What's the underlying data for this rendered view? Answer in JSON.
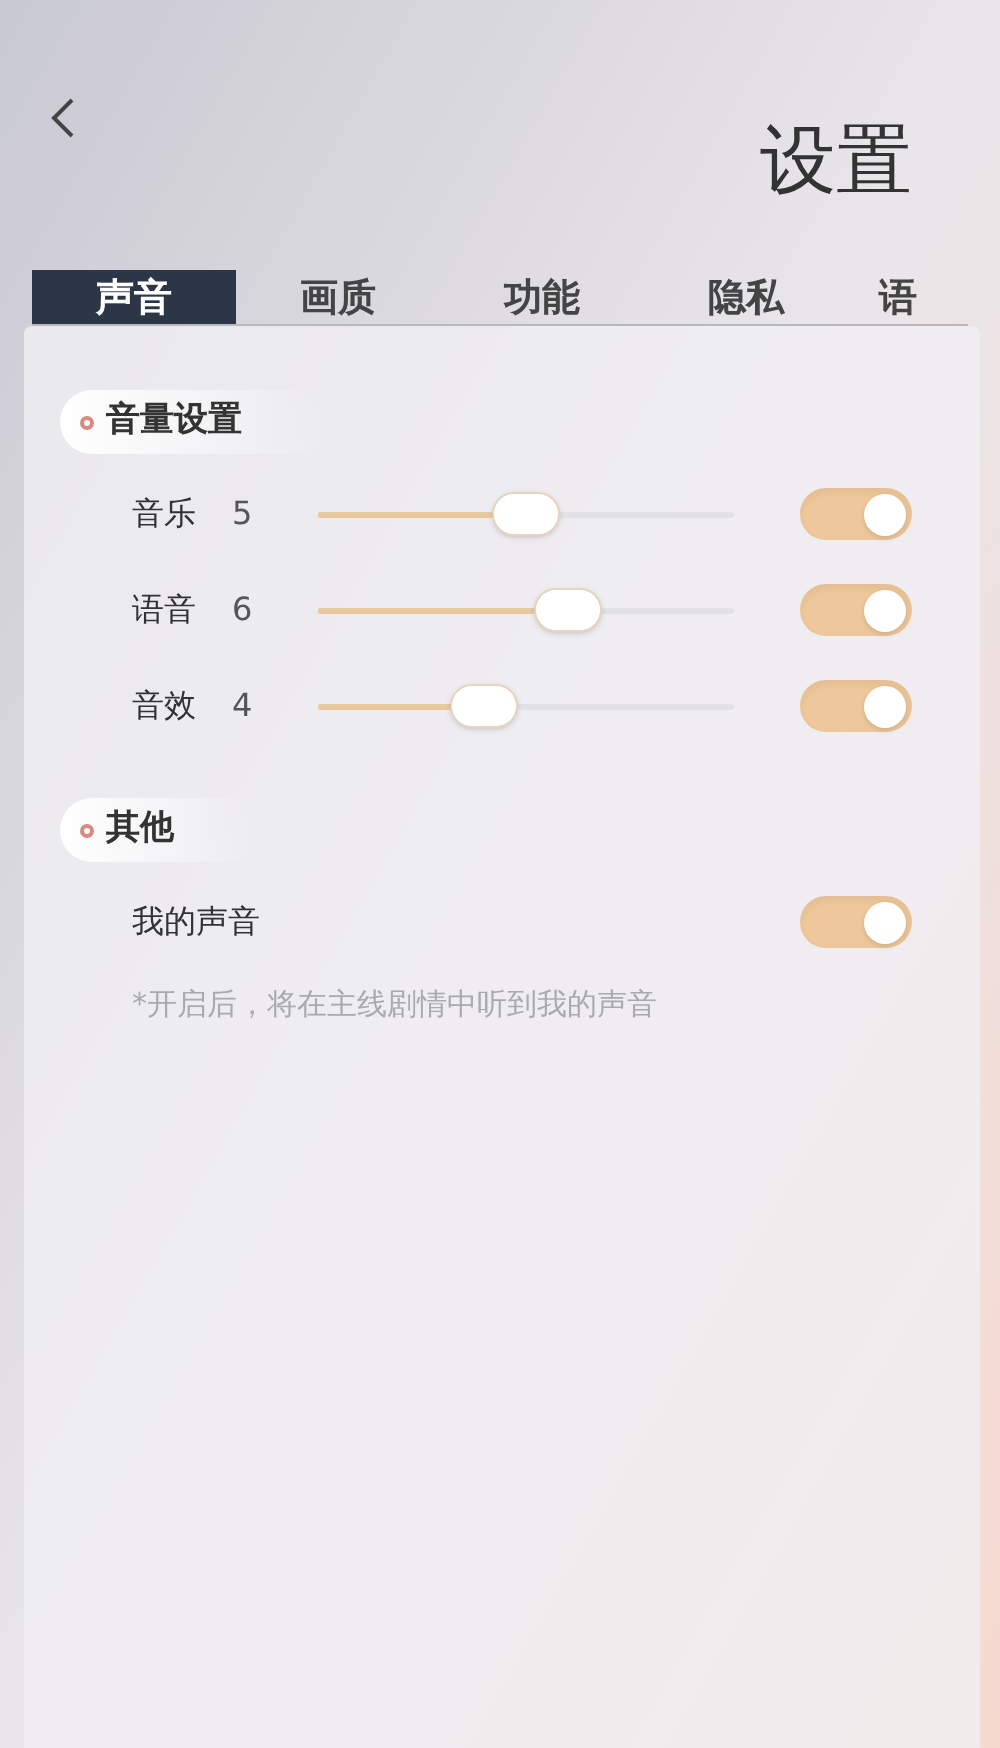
{
  "header": {
    "title": "设置"
  },
  "tabs": [
    {
      "label": "声音",
      "selected": true
    },
    {
      "label": "画质",
      "selected": false
    },
    {
      "label": "功能",
      "selected": false
    },
    {
      "label": "隐私",
      "selected": false
    },
    {
      "label": "语",
      "selected": false
    }
  ],
  "sections": [
    {
      "title": "音量设置",
      "rows": [
        {
          "kind": "slider",
          "label": "音乐",
          "reading": "5",
          "level": 0.5,
          "on": true
        },
        {
          "kind": "slider",
          "label": "语音",
          "reading": "6",
          "level": 0.6,
          "on": true
        },
        {
          "kind": "slider",
          "label": "音效",
          "reading": "4",
          "level": 0.4,
          "on": true
        }
      ]
    },
    {
      "title": "其他",
      "rows": [
        {
          "kind": "toggle",
          "label": "我的声音",
          "on": true
        },
        {
          "kind": "note",
          "label": "*开启后，将在主线剧情中听到我的声音"
        }
      ]
    }
  ]
}
